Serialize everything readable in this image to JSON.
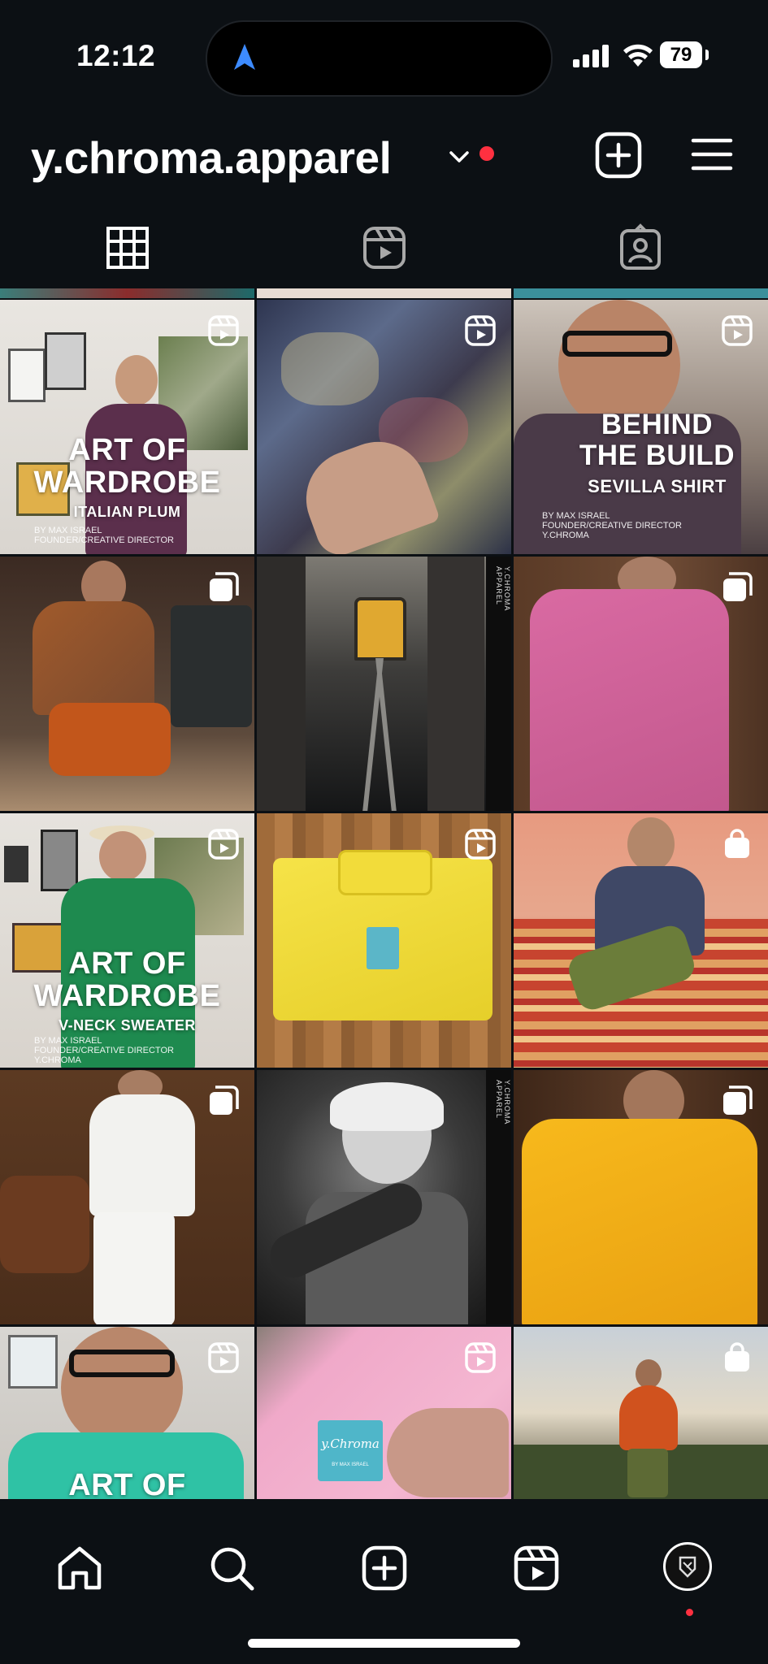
{
  "status_bar": {
    "time": "12:12",
    "battery": "79"
  },
  "profile": {
    "username": "y.chroma.apparel"
  },
  "tabs": [
    {
      "name": "posts-grid",
      "icon": "grid-icon",
      "active": true
    },
    {
      "name": "reels",
      "icon": "reels-icon",
      "active": false
    },
    {
      "name": "tagged",
      "icon": "tagged-person-icon",
      "active": false
    }
  ],
  "posts": {
    "p1": {
      "title_line1": "ART OF",
      "title_line2": "WARDROBE",
      "subtitle": "ITALIAN PLUM",
      "credit_line1": "BY MAX ISRAEL",
      "credit_line2": "FOUNDER/CREATIVE DIRECTOR",
      "type": "reel"
    },
    "p2": {
      "type": "reel"
    },
    "p3": {
      "title_line1": "BEHIND",
      "title_line2": "THE BUILD",
      "subtitle": "SEVILLA SHIRT",
      "credit_line1": "BY MAX ISRAEL",
      "credit_line2": "FOUNDER/CREATIVE DIRECTOR",
      "credit_line3": "Y.CHROMA",
      "type": "reel"
    },
    "p4": {
      "type": "carousel"
    },
    "p5": {
      "side_text": "Y.CHROMA APPAREL",
      "type": "image"
    },
    "p6": {
      "type": "carousel"
    },
    "p7": {
      "title_line1": "ART OF",
      "title_line2": "WARDROBE",
      "subtitle": "V-NECK SWEATER",
      "credit_line1": "BY MAX ISRAEL",
      "credit_line2": "FOUNDER/CREATIVE DIRECTOR",
      "credit_line3": "Y.CHROMA",
      "type": "reel"
    },
    "p8": {
      "type": "reel"
    },
    "p9": {
      "type": "shop"
    },
    "p10": {
      "type": "carousel"
    },
    "p11": {
      "side_text": "Y.CHROMA APPAREL",
      "type": "image"
    },
    "p12": {
      "type": "carousel"
    },
    "p13": {
      "title_line1": "ART OF",
      "type": "reel"
    },
    "p14": {
      "tag_text": "y.Chroma",
      "tag_sub": "BY MAX ISRAEL",
      "type": "reel"
    },
    "p15": {
      "type": "shop"
    }
  },
  "bottom_nav": [
    {
      "name": "home",
      "icon": "home-icon"
    },
    {
      "name": "search",
      "icon": "search-icon"
    },
    {
      "name": "create",
      "icon": "create-icon"
    },
    {
      "name": "reels",
      "icon": "reels-icon"
    },
    {
      "name": "profile",
      "icon": "avatar"
    }
  ]
}
